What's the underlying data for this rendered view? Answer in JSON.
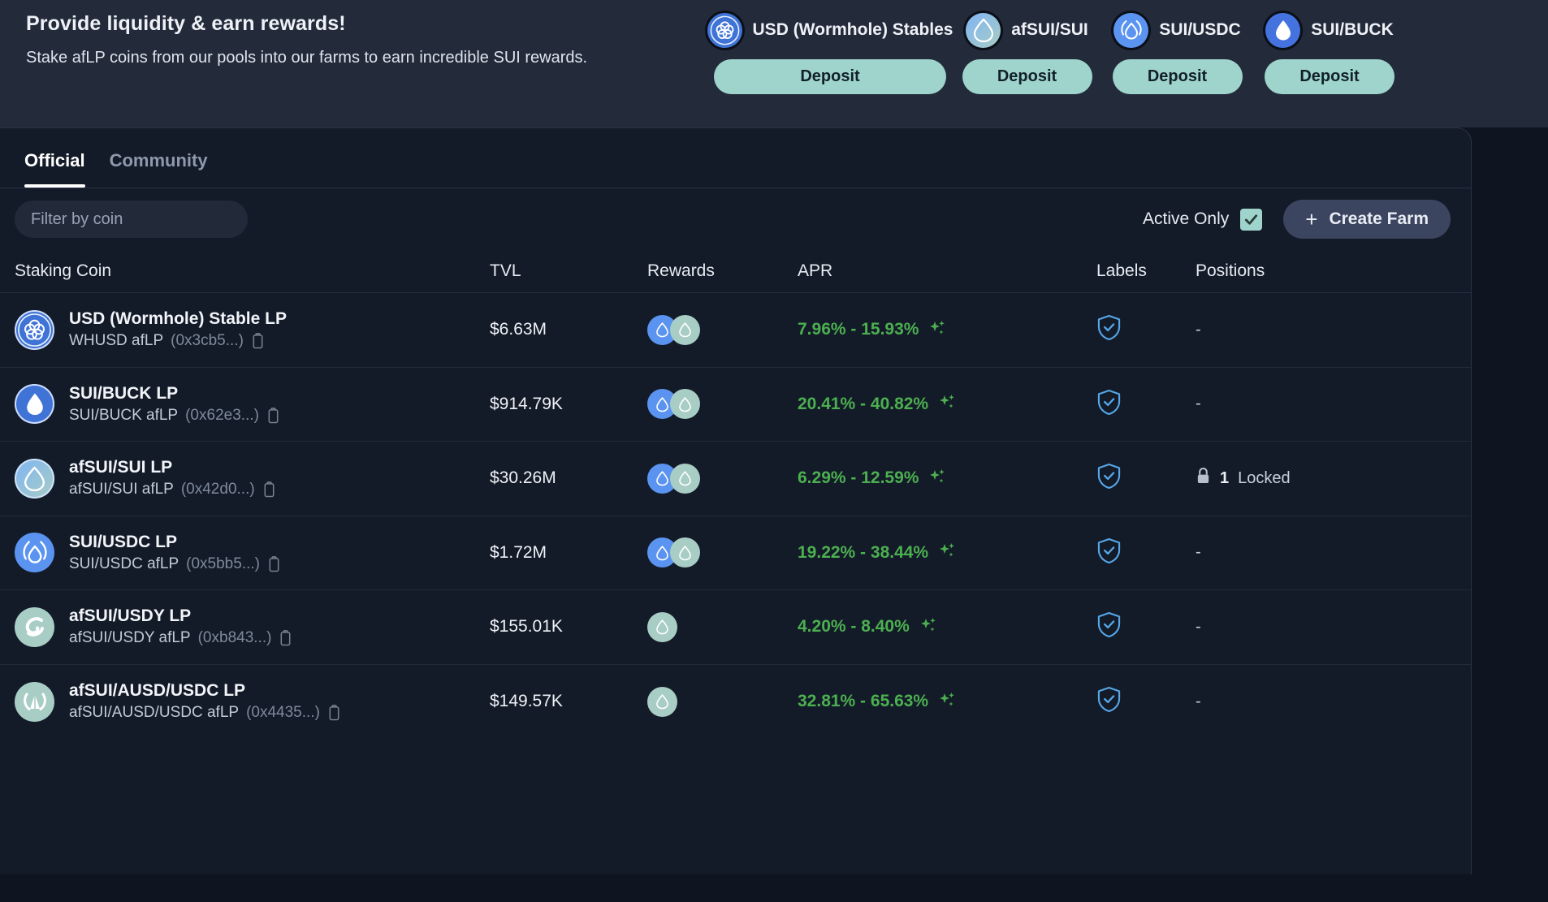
{
  "banner": {
    "title": "Provide liquidity & earn rewards!",
    "subtitle": "Stake afLP coins from our pools into our farms to earn incredible SUI rewards.",
    "promos": [
      {
        "name": "USD (Wormhole) Stables",
        "button": "Deposit",
        "icon": "wormhole-coin-icon"
      },
      {
        "name": "afSUI/SUI",
        "button": "Deposit",
        "icon": "afsui-sui-coin-icon"
      },
      {
        "name": "SUI/USDC",
        "button": "Deposit",
        "icon": "sui-usdc-coin-icon"
      },
      {
        "name": "SUI/BUCK",
        "button": "Deposit",
        "icon": "sui-buck-coin-icon"
      }
    ]
  },
  "tabs": [
    {
      "label": "Official",
      "active": true
    },
    {
      "label": "Community",
      "active": false
    }
  ],
  "toolbar": {
    "filter_placeholder": "Filter by coin",
    "filter_value": "",
    "active_only_label": "Active Only",
    "active_only_checked": true,
    "create_farm_label": "Create Farm",
    "plus_glyph": "+"
  },
  "table": {
    "columns": [
      "Staking Coin",
      "TVL",
      "Rewards",
      "APR",
      "Labels",
      "Positions"
    ],
    "rows": [
      {
        "name": "USD (Wormhole) Stable LP",
        "symbol": "WHUSD afLP",
        "address": "(0x3cb5...)",
        "tvl": "$6.63M",
        "rewards": [
          "sui-blue",
          "afsui-green"
        ],
        "apr": "7.96% - 15.93%",
        "label": "verified-shield",
        "position": "-",
        "position_type": "none",
        "icon": "wormhole"
      },
      {
        "name": "SUI/BUCK LP",
        "symbol": "SUI/BUCK afLP",
        "address": "(0x62e3...)",
        "tvl": "$914.79K",
        "rewards": [
          "sui-blue",
          "afsui-green"
        ],
        "apr": "20.41% - 40.82%",
        "label": "verified-shield",
        "position": "-",
        "position_type": "none",
        "icon": "buck"
      },
      {
        "name": "afSUI/SUI LP",
        "symbol": "afSUI/SUI afLP",
        "address": "(0x42d0...)",
        "tvl": "$30.26M",
        "rewards": [
          "sui-blue",
          "afsui-green"
        ],
        "apr": "6.29% - 12.59%",
        "label": "verified-shield",
        "position_count": "1",
        "position": "Locked",
        "position_type": "locked",
        "icon": "afsui-sui"
      },
      {
        "name": "SUI/USDC LP",
        "symbol": "SUI/USDC afLP",
        "address": "(0x5bb5...)",
        "tvl": "$1.72M",
        "rewards": [
          "sui-blue",
          "afsui-green"
        ],
        "apr": "19.22% - 38.44%",
        "label": "verified-shield",
        "position": "-",
        "position_type": "none",
        "icon": "sui-usdc"
      },
      {
        "name": "afSUI/USDY LP",
        "symbol": "afSUI/USDY afLP",
        "address": "(0xb843...)",
        "tvl": "$155.01K",
        "rewards": [
          "afsui-green"
        ],
        "apr": "4.20% - 8.40%",
        "label": "verified-shield",
        "position": "-",
        "position_type": "none",
        "icon": "usdy"
      },
      {
        "name": "afSUI/AUSD/USDC LP",
        "symbol": "afSUI/AUSD/USDC afLP",
        "address": "(0x4435...)",
        "tvl": "$149.57K",
        "rewards": [
          "afsui-green"
        ],
        "apr": "32.81% - 65.63%",
        "label": "verified-shield",
        "position": "-",
        "position_type": "none",
        "icon": "ausd"
      }
    ]
  },
  "colors": {
    "banner_bg": "#232b3b",
    "page_bg": "#0f1520",
    "card_bg": "#131b28",
    "accent_mint": "#9fd4cd",
    "apr_green": "#4caf50",
    "sui_blue": "#5b94f0",
    "afsui_green": "#a8cdc4",
    "shield_blue": "#56a6e8"
  }
}
